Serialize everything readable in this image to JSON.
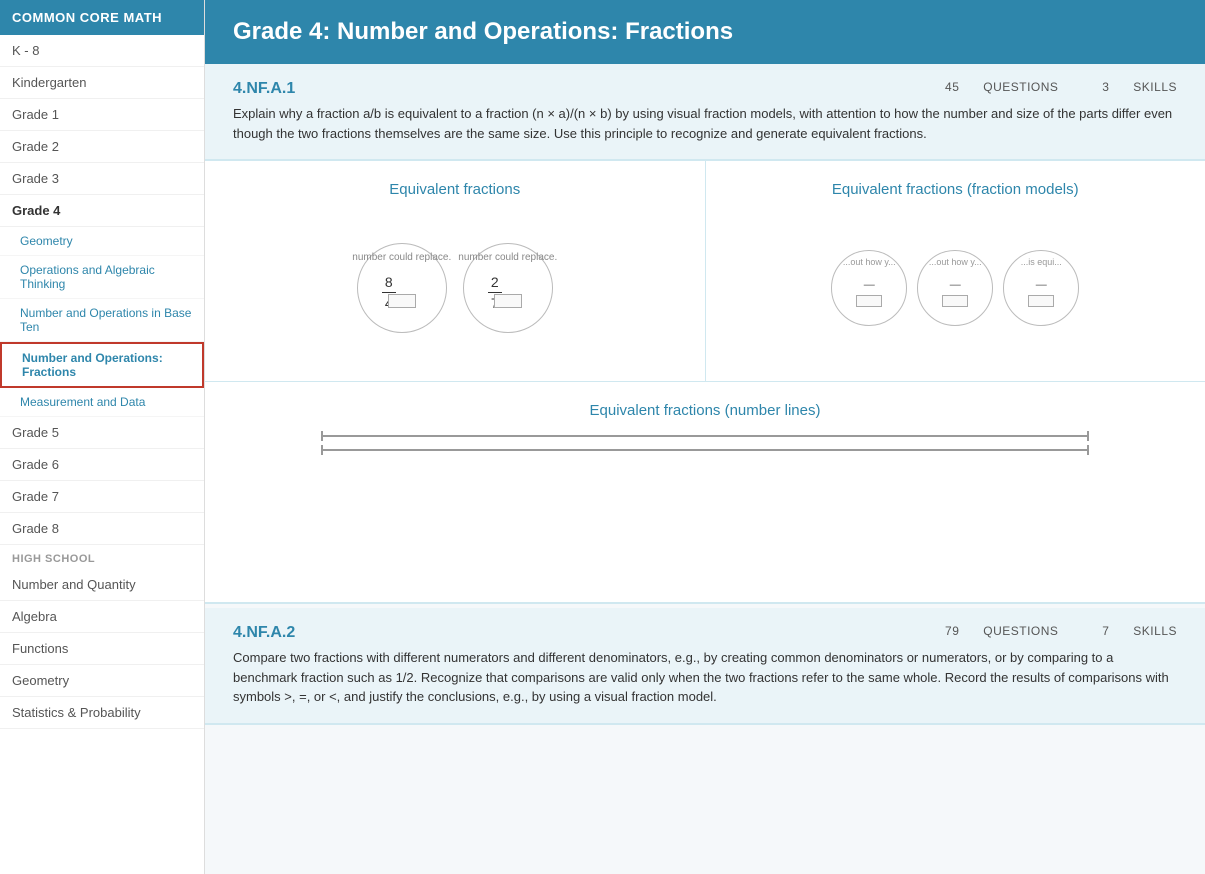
{
  "sidebar": {
    "header": "COMMON CORE MATH",
    "items": [
      {
        "id": "k8",
        "label": "K - 8",
        "type": "grade"
      },
      {
        "id": "kindergarten",
        "label": "Kindergarten",
        "type": "grade"
      },
      {
        "id": "grade1",
        "label": "Grade 1",
        "type": "grade"
      },
      {
        "id": "grade2",
        "label": "Grade 2",
        "type": "grade"
      },
      {
        "id": "grade3",
        "label": "Grade 3",
        "type": "grade"
      },
      {
        "id": "grade4",
        "label": "Grade 4",
        "type": "grade",
        "active": true
      },
      {
        "id": "geometry",
        "label": "Geometry",
        "type": "sub"
      },
      {
        "id": "operations-algebraic",
        "label": "Operations and Algebraic Thinking",
        "type": "sub"
      },
      {
        "id": "number-operations-base",
        "label": "Number and Operations in Base Ten",
        "type": "sub"
      },
      {
        "id": "number-operations-fractions",
        "label": "Number and Operations: Fractions",
        "type": "sub",
        "active": true
      },
      {
        "id": "measurement-data",
        "label": "Measurement and Data",
        "type": "sub"
      },
      {
        "id": "grade5",
        "label": "Grade 5",
        "type": "grade"
      },
      {
        "id": "grade6",
        "label": "Grade 6",
        "type": "grade"
      },
      {
        "id": "grade7",
        "label": "Grade 7",
        "type": "grade"
      },
      {
        "id": "grade8",
        "label": "Grade 8",
        "type": "grade"
      },
      {
        "id": "highschool",
        "label": "HIGH SCHOOL",
        "type": "section"
      },
      {
        "id": "number-quantity",
        "label": "Number and Quantity",
        "type": "grade"
      },
      {
        "id": "algebra",
        "label": "Algebra",
        "type": "grade"
      },
      {
        "id": "functions",
        "label": "Functions",
        "type": "grade"
      },
      {
        "id": "hs-geometry",
        "label": "Geometry",
        "type": "grade"
      },
      {
        "id": "statistics",
        "label": "Statistics & Probability",
        "type": "grade"
      }
    ]
  },
  "page": {
    "title": "Grade 4: Number and Operations: Fractions",
    "standards": [
      {
        "id": "4.NF.A.1",
        "questions": 45,
        "skills": 3,
        "description": "Explain why a fraction a/b is equivalent to a fraction (n × a)/(n × b) by using visual fraction models, with attention to how the number and size of the parts differ even though the two fractions themselves are the same size. Use this principle to recognize and generate equivalent fractions.",
        "skill_cards": [
          {
            "id": "eq-fractions",
            "title": "Equivalent fractions",
            "type": "two-circles"
          },
          {
            "id": "eq-fractions-models",
            "title": "Equivalent fractions (fraction models)",
            "type": "three-circles"
          },
          {
            "id": "eq-fractions-lines",
            "title": "Equivalent fractions (number lines)",
            "type": "number-lines",
            "full_width": true
          }
        ]
      },
      {
        "id": "4.NF.A.2",
        "questions": 79,
        "skills": 7,
        "description": "Compare two fractions with different numerators and different denominators, e.g., by creating common denominators or numerators, or by comparing to a benchmark fraction such as 1/2. Recognize that comparisons are valid only when the two fractions refer to the same whole. Record the results of comparisons with symbols >, =, or <, and justify the conclusions, e.g., by using a visual fraction model.",
        "skill_cards": []
      }
    ]
  },
  "labels": {
    "questions": "QUESTIONS",
    "skills": "SKILLS",
    "circle1_label": "number could replace.",
    "circle2_label": "number could replace.",
    "frac1_num": "8",
    "frac1_den": "4",
    "frac2_num": "2",
    "frac2_den": "7",
    "sm_label1": "...out how y...",
    "sm_label2": "...out how y...",
    "sm_label3": "...is equi..."
  }
}
